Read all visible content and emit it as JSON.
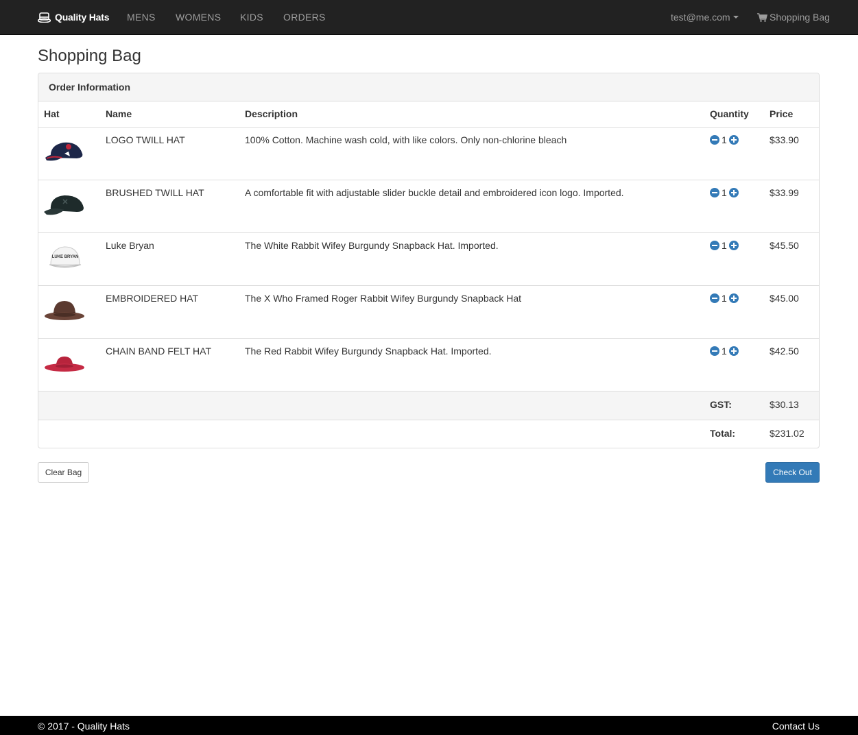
{
  "nav": {
    "brand": "Quality Hats",
    "links": [
      "MENS",
      "WOMENS",
      "KIDS",
      "ORDERS"
    ],
    "user": "test@me.com",
    "bag": "Shopping Bag",
    "colors": {
      "bar": "#222222",
      "link": "#9d9d9d"
    }
  },
  "page": {
    "title": "Shopping Bag"
  },
  "panel": {
    "heading": "Order Information",
    "columns": [
      "Hat",
      "Name",
      "Description",
      "Quantity",
      "Price"
    ],
    "items": [
      {
        "image": "navy-logo-cap-icon",
        "name": "LOGO TWILL HAT",
        "description": "100% Cotton. Machine wash cold, with like colors. Only non-chlorine bleach",
        "quantity": "1",
        "price": "$33.90"
      },
      {
        "image": "dark-green-cap-icon",
        "name": "BRUSHED TWILL HAT",
        "description": "A comfortable fit with adjustable slider buckle detail and embroidered icon logo. Imported.",
        "quantity": "1",
        "price": "$33.99"
      },
      {
        "image": "white-snapback-icon",
        "name": "Luke Bryan",
        "description": "The White Rabbit Wifey Burgundy Snapback Hat. Imported.",
        "quantity": "1",
        "price": "$45.50"
      },
      {
        "image": "brown-fedora-icon",
        "name": "EMBROIDERED HAT",
        "description": "The X Who Framed Roger Rabbit Wifey Burgundy Snapback Hat",
        "quantity": "1",
        "price": "$45.00"
      },
      {
        "image": "red-felt-hat-icon",
        "name": "CHAIN BAND FELT HAT",
        "description": "The Red Rabbit Wifey Burgundy Snapback Hat. Imported.",
        "quantity": "1",
        "price": "$42.50"
      }
    ],
    "gst_label": "GST:",
    "gst_value": "$30.13",
    "total_label": "Total:",
    "total_value": "$231.02",
    "snapback_text": "LUKE BRYAN"
  },
  "actions": {
    "clear": "Clear Bag",
    "checkout": "Check Out",
    "accent": "#337ab7"
  },
  "footer": {
    "copyright": "© 2017 - Quality Hats",
    "contact": "Contact Us"
  }
}
